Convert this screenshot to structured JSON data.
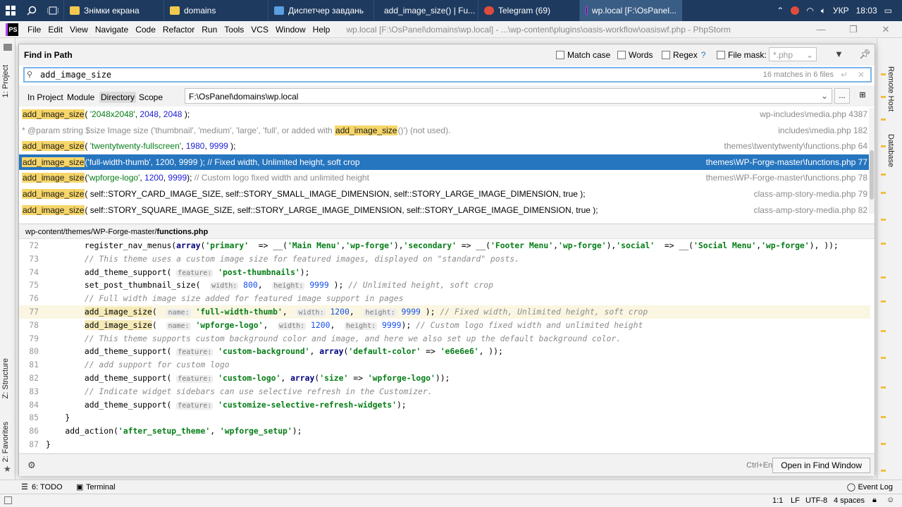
{
  "taskbar": {
    "buttons": [
      {
        "label": "Знімки екрана",
        "color": "#f2c94c"
      },
      {
        "label": "domains",
        "color": "#f2c94c"
      },
      {
        "label": "Диспетчер завдань",
        "color": "#5aa0e0"
      },
      {
        "label": "add_image_size() | Fu...",
        "color": "#e04c3c"
      },
      {
        "label": "Telegram (69)",
        "color": "#e04c3c"
      },
      {
        "label": "wp.local [F:\\OsPanel...",
        "color": "#222222"
      }
    ],
    "lang": "УКР",
    "time": "18:03"
  },
  "menubar": {
    "items": [
      "File",
      "Edit",
      "View",
      "Navigate",
      "Code",
      "Refactor",
      "Run",
      "Tools",
      "VCS",
      "Window",
      "Help"
    ],
    "window_title": "wp.local [F:\\OsPanel\\domains\\wp.local] - ...\\wp-content\\plugins\\oasis-workflow\\oasiswf.php - PhpStorm"
  },
  "find": {
    "title": "Find in Path",
    "match_case": "Match case",
    "words": "Words",
    "regex": "Regex",
    "regex_help": "?",
    "file_mask": "File mask:",
    "file_mask_value": "*.php",
    "query": "add_image_size",
    "match_count": "16 matches in 6 files",
    "scopes": [
      "In Project",
      "Module",
      "Directory",
      "Scope"
    ],
    "directory": "F:\\OsPanel\\domains\\wp.local",
    "dir_browse": "...",
    "shortcut": "Ctrl+Enter",
    "open_button": "Open in Find Window"
  },
  "results": [
    {
      "match": "add_image_size",
      "rest": "( '2048x2048', 2048, 2048 );",
      "file": "wp-includes\\media.php 4387",
      "selected": false
    },
    {
      "pre": "* @param string  $size   Image size ('thumbnail', 'medium', 'large', 'full', or added with ",
      "match": "add_image_size",
      "rest": "()') (not used).",
      "file": "includes\\media.php 182",
      "selected": false
    },
    {
      "match": "add_image_size",
      "rest": "( 'twentytwenty-fullscreen', 1980, 9999 );",
      "file": "themes\\twentytwenty\\functions.php 64",
      "selected": false
    },
    {
      "match": "add_image_size",
      "rest": "('full-width-thumb', 1200, 9999 ); // Fixed width, Unlimited height, soft crop",
      "file": "themes\\WP-Forge-master\\functions.php 77",
      "selected": true
    },
    {
      "match": "add_image_size",
      "rest": "('wpforge-logo', 1200, 9999); // Custom logo fixed width and unlimited height",
      "file": "themes\\WP-Forge-master\\functions.php 78",
      "selected": false
    },
    {
      "match": "add_image_size",
      "rest": "( self::STORY_CARD_IMAGE_SIZE, self::STORY_SMALL_IMAGE_DIMENSION, self::STORY_LARGE_IMAGE_DIMENSION, true );",
      "file": "class-amp-story-media.php 79",
      "selected": false
    },
    {
      "match": "add_image_size",
      "rest": "( self::STORY_SQUARE_IMAGE_SIZE, self::STORY_LARGE_IMAGE_DIMENSION, self::STORY_LARGE_IMAGE_DIMENSION, true );",
      "file": "class-amp-story-media.php 82",
      "selected": false
    }
  ],
  "path": {
    "dir": "wp-content/themes/WP-Forge-master/",
    "file": "functions.php"
  },
  "code_lines": [
    "72",
    "73",
    "74",
    "75",
    "76",
    "77",
    "78",
    "79",
    "80",
    "81",
    "82",
    "83",
    "84",
    "85",
    "86",
    "87"
  ],
  "left_tabs": {
    "project": "1: Project",
    "structure": "Z: Structure",
    "favorites": "2: Favorites"
  },
  "right_tabs": {
    "remote": "Remote Host",
    "database": "Database"
  },
  "bottom_tabs": {
    "todo": "6: TODO",
    "terminal": "Terminal",
    "event_log": "Event Log"
  },
  "status": {
    "pos": "1:1",
    "le": "LF",
    "enc": "UTF-8",
    "indent": "4 spaces"
  }
}
